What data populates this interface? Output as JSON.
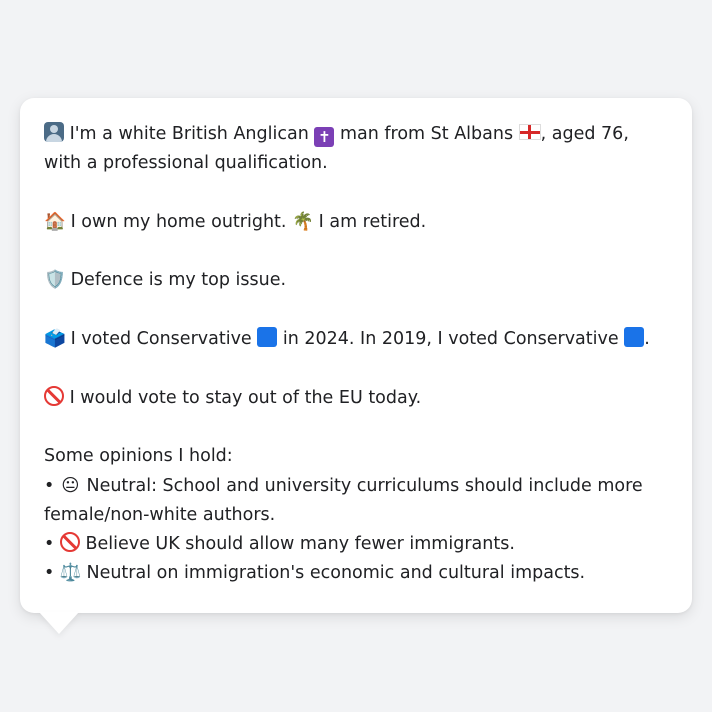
{
  "card": {
    "identity": {
      "icon": "bust-in-silhouette-icon",
      "text_a": "I'm a white British Anglican",
      "religion_icon": "latin-cross-icon",
      "text_b": "man from St Albans",
      "flag_icon": "england-flag-icon",
      "text_c": ", aged 76, with a professional qualification."
    },
    "home": {
      "home_icon": "house-icon",
      "home_text": "I own my home outright.",
      "retired_icon": "palm-tree-icon",
      "retired_text": "I am retired."
    },
    "issue": {
      "icon": "shield-icon",
      "text": "Defence is my top issue."
    },
    "vote": {
      "icon": "ballot-box-icon",
      "text_a": "I voted Conservative",
      "text_b": "in 2024. In 2019, I voted Conservative",
      "text_c": ".",
      "party_color": "#1a73e8",
      "party_icon": "blue-square-icon"
    },
    "eu": {
      "icon": "no-entry-icon",
      "text": "I would vote to stay out of the EU today."
    },
    "opinions": {
      "heading": "Some opinions I hold:",
      "items": [
        {
          "bullet": "•",
          "icon": "neutral-face-icon",
          "glyph": "😐",
          "text": "Neutral: School and university curriculums should include more female/non-white authors."
        },
        {
          "bullet": "•",
          "icon": "no-entry-icon",
          "glyph": "",
          "text": "Believe UK should allow many fewer immigrants."
        },
        {
          "bullet": "•",
          "icon": "balance-scale-icon",
          "glyph": "⚖️",
          "text": "Neutral on immigration's economic and cultural impacts."
        }
      ]
    },
    "glyphs": {
      "cross": "✝",
      "house": "🏠",
      "palm": "🌴",
      "shield": "🛡️",
      "ballot": "🗳️"
    }
  }
}
